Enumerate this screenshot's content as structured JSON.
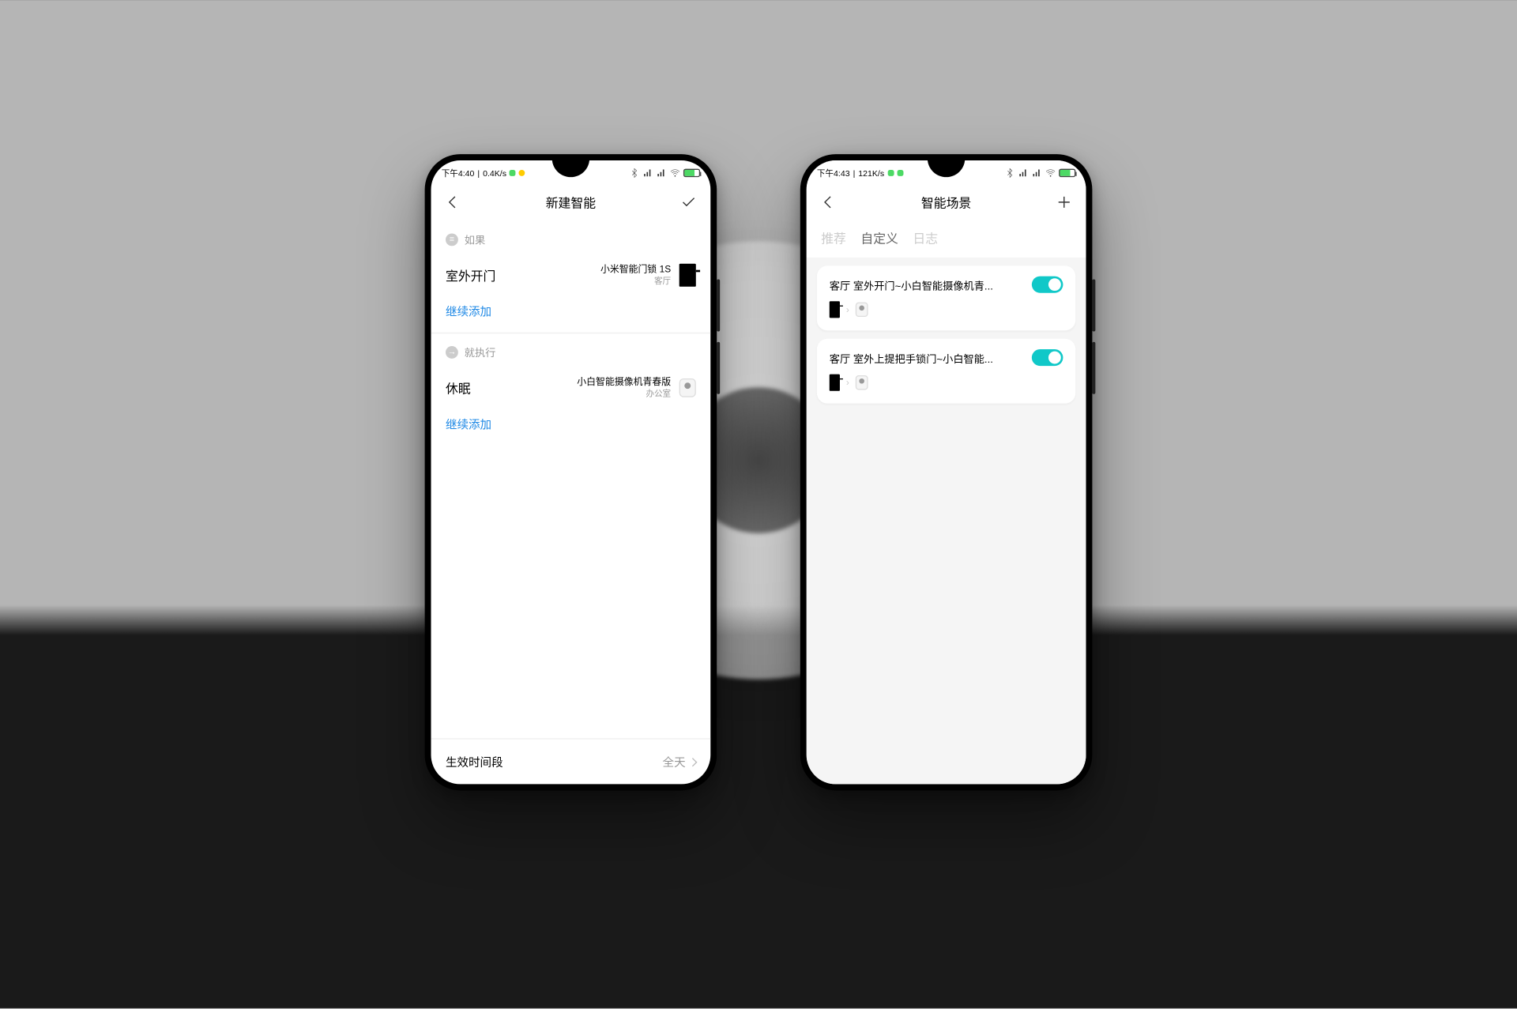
{
  "left": {
    "status": {
      "time": "下午4:40",
      "net": "0.4K/s"
    },
    "header": {
      "title": "新建智能"
    },
    "if_label": "如果",
    "if_item": {
      "action": "室外开门",
      "device": "小米智能门锁 1S",
      "room": "客厅"
    },
    "add_more": "继续添加",
    "then_label": "就执行",
    "then_item": {
      "action": "休眠",
      "device": "小白智能摄像机青春版",
      "room": "办公室"
    },
    "footer": {
      "label": "生效时间段",
      "value": "全天"
    }
  },
  "right": {
    "status": {
      "time": "下午4:43",
      "net": "121K/s"
    },
    "header": {
      "title": "智能场景"
    },
    "tabs": {
      "recommend": "推荐",
      "custom": "自定义",
      "log": "日志"
    },
    "scenes": [
      {
        "title": "客厅 室外开门~小白智能摄像机青...",
        "on": true
      },
      {
        "title": "客厅 室外上提把手锁门~小白智能...",
        "on": true
      }
    ]
  }
}
